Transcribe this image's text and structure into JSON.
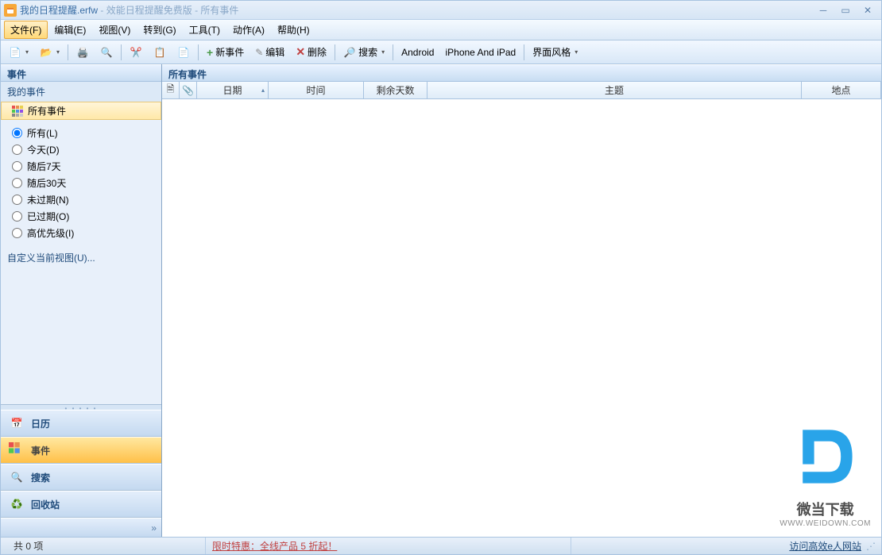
{
  "title": {
    "filename": "我的日程提醒.erfw",
    "app": "效能日程提醒免费版",
    "view": "所有事件"
  },
  "menu": {
    "file": "文件(F)",
    "edit": "编辑(E)",
    "view": "视图(V)",
    "goto": "转到(G)",
    "tools": "工具(T)",
    "action": "动作(A)",
    "help": "帮助(H)"
  },
  "toolbar": {
    "new_event": "新事件",
    "edit": "编辑",
    "delete": "删除",
    "search": "搜索",
    "android": "Android",
    "iphone": "iPhone And iPad",
    "style": "界面风格"
  },
  "sidebar": {
    "header": "事件",
    "my_events": "我的事件",
    "all_events": "所有事件",
    "filters": {
      "all": "所有(L)",
      "today": "今天(D)",
      "next7": "随后7天",
      "next30": "随后30天",
      "not_expired": "未过期(N)",
      "expired": "已过期(O)",
      "high_priority": "高优先级(I)"
    },
    "customize": "自定义当前视图(U)...",
    "nav": {
      "calendar": "日历",
      "events": "事件",
      "search": "搜索",
      "recycle": "回收站"
    }
  },
  "main": {
    "header": "所有事件",
    "columns": {
      "date": "日期",
      "time": "时间",
      "days_left": "剩余天数",
      "subject": "主题",
      "location": "地点"
    }
  },
  "status": {
    "count": "共 0 项",
    "promo": "限时特惠：全线产品 5 折起！",
    "link": "访问高效e人网站"
  },
  "watermark": {
    "name": "微当下载",
    "url": "WWW.WEIDOWN.COM"
  }
}
